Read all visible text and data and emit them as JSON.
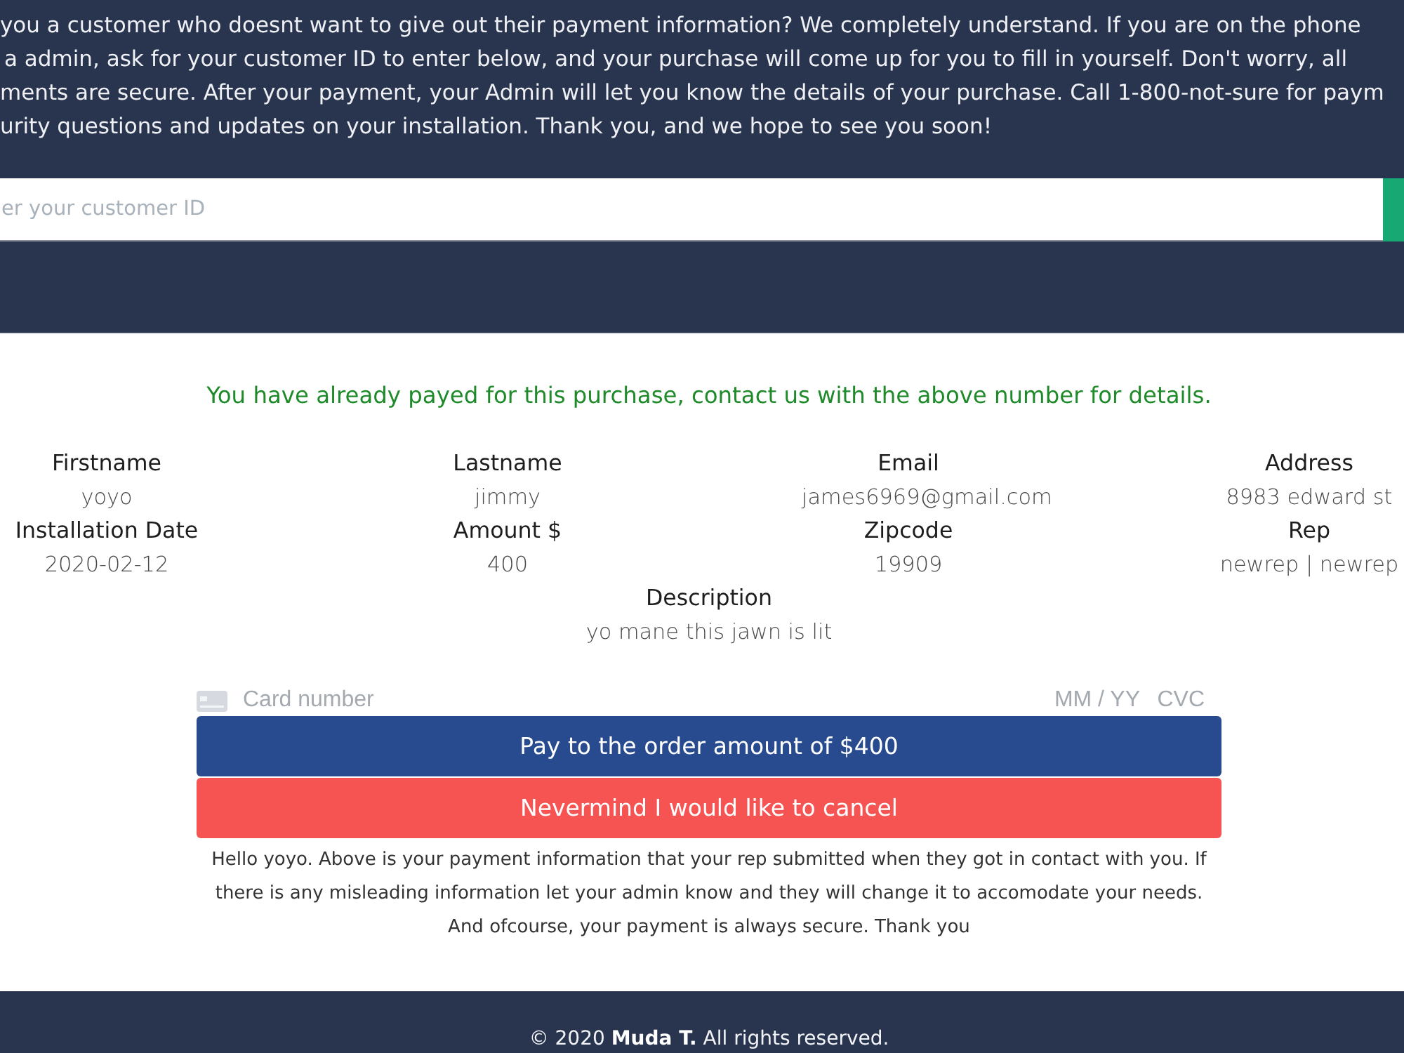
{
  "header": {
    "intro_lines": [
      "you a customer who doesnt want to give out their payment information? We completely understand. If you are on the phone",
      "a admin, ask for your customer ID to enter below, and your purchase will come up for you to fill in yourself. Don't worry, all",
      "ments are secure. After your payment, your Admin will let you know the details of your purchase. Call 1-800-not-sure for paym",
      "urity questions and updates on your installation. Thank you, and we hope to see you soon!"
    ],
    "customer_id": {
      "placeholder": "er your customer ID"
    }
  },
  "notice": "You have already payed for this purchase, contact us with the above number for details.",
  "details": [
    {
      "label": "Firstname",
      "value": "yoyo",
      "kind": "column"
    },
    {
      "label": "Lastname",
      "value": "jimmy",
      "kind": "column"
    },
    {
      "label": "Email",
      "value": "james6969@gmail.com",
      "kind": "column"
    },
    {
      "label": "Address",
      "value": "8983 edward st",
      "kind": "column"
    },
    {
      "label": "Installation Date",
      "value": "2020-02-12",
      "kind": "column"
    },
    {
      "label": "Amount $",
      "value": "400",
      "kind": "column"
    },
    {
      "label": "Zipcode",
      "value": "19909",
      "kind": "column"
    },
    {
      "label": "Rep",
      "value": "newrep | newrep",
      "kind": "column"
    },
    {
      "label": "Description",
      "value": "yo mane this jawn is lit",
      "kind": "full"
    }
  ],
  "payment": {
    "card_placeholder": "Card number",
    "expiry_placeholder": "MM / YY",
    "cvc_placeholder": "CVC",
    "buttons": [
      {
        "label": "Pay to the order amount of $400",
        "kind": "pay"
      },
      {
        "label": "Nevermind I would like to cancel",
        "kind": "cancel"
      }
    ],
    "note": "Hello yoyo. Above is your payment information that your rep submitted when they got in contact with you. If there is any misleading information let your admin know and they will change it to accomodate your needs. And ofcourse, your payment is always secure. Thank you"
  },
  "footer": {
    "text": "© 2020 **Muda T.** All rights reserved."
  }
}
